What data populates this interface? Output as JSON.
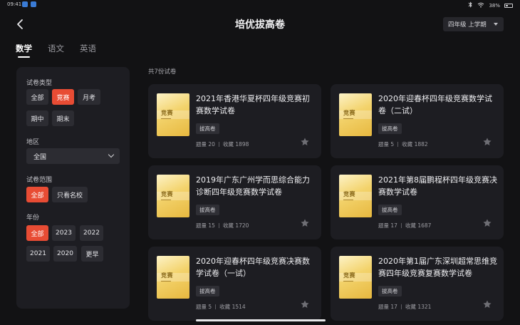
{
  "status_bar": {
    "time": "09:41",
    "battery": "38%"
  },
  "header": {
    "title": "培优拔高卷",
    "grade_select": "四年级 上学期"
  },
  "tabs": [
    {
      "label": "数学",
      "active": true
    },
    {
      "label": "语文",
      "active": false
    },
    {
      "label": "英语",
      "active": false
    }
  ],
  "filters": {
    "type": {
      "label": "试卷类型",
      "options": [
        "全部",
        "竞赛",
        "月考",
        "期中",
        "期末"
      ],
      "selected": "竞赛"
    },
    "region": {
      "label": "地区",
      "value": "全国"
    },
    "scope": {
      "label": "试卷范围",
      "options": [
        "全部",
        "只看名校"
      ],
      "selected": "全部"
    },
    "year": {
      "label": "年份",
      "options": [
        "全部",
        "2023",
        "2022",
        "2021",
        "2020",
        "更早"
      ],
      "selected": "全部"
    }
  },
  "results": {
    "count_text": "共7份试卷",
    "count_label": "题量",
    "fav_label": "收藏",
    "thumb_label": "竞赛",
    "cards": [
      {
        "title": "2021年香港华夏杯四年级竞赛初赛数学试卷",
        "tag": "拔高卷",
        "questions": "20",
        "favorites": "1898"
      },
      {
        "title": "2020年迎春杯四年级竞赛数学试卷（二试）",
        "tag": "拔高卷",
        "questions": "5",
        "favorites": "1882"
      },
      {
        "title": "2019年广东广州学而思综合能力诊断四年级竞赛数学试卷",
        "tag": "拔高卷",
        "questions": "15",
        "favorites": "1720"
      },
      {
        "title": "2021年第8届鹏程杯四年级竞赛决赛数学试卷",
        "tag": "拔高卷",
        "questions": "17",
        "favorites": "1687"
      },
      {
        "title": "2020年迎春杯四年级竞赛决赛数学试卷（一试）",
        "tag": "拔高卷",
        "questions": "5",
        "favorites": "1514"
      },
      {
        "title": "2020年第1届广东深圳超常思维竞赛四年级竞赛复赛数学试卷",
        "tag": "拔高卷",
        "questions": "17",
        "favorites": "1321"
      }
    ]
  },
  "colors": {
    "accent": "#e84c34",
    "background": "#121214",
    "panel": "#1d1d22",
    "chip": "#2c2c32"
  }
}
